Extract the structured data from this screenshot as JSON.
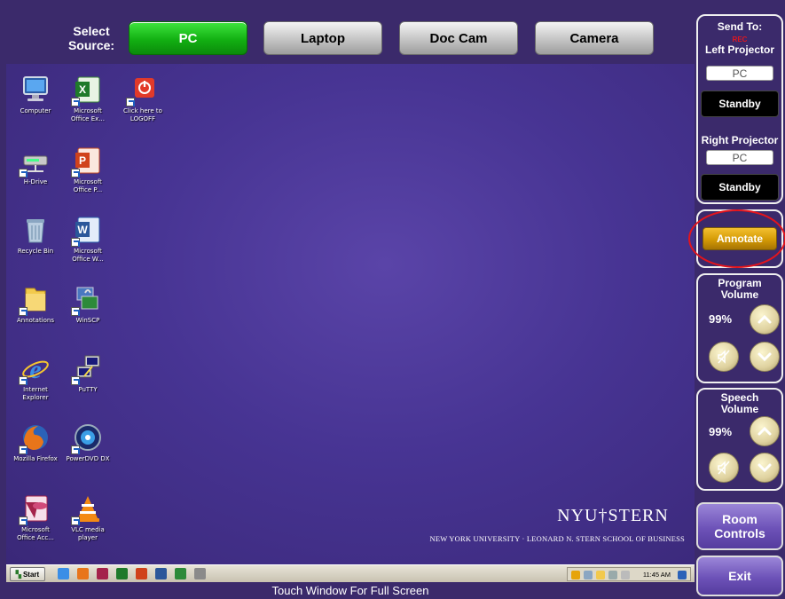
{
  "source_bar": {
    "label": "Select\nSource:",
    "buttons": [
      {
        "label": "PC",
        "active": true
      },
      {
        "label": "Laptop",
        "active": false
      },
      {
        "label": "Doc Cam",
        "active": false
      },
      {
        "label": "Camera",
        "active": false
      }
    ]
  },
  "desktop": {
    "icons": [
      {
        "label": "Computer",
        "icon": "computer-icon"
      },
      {
        "label": "Microsoft\nOffice Ex...",
        "icon": "excel-icon"
      },
      {
        "label": "Click here to\nLOGOFF",
        "icon": "logoff-icon"
      },
      {
        "label": "H-Drive",
        "icon": "network-drive-icon"
      },
      {
        "label": "Microsoft\nOffice P...",
        "icon": "powerpoint-icon"
      },
      {
        "label": "Recycle Bin",
        "icon": "recycle-bin-icon"
      },
      {
        "label": "Microsoft\nOffice W...",
        "icon": "word-icon"
      },
      {
        "label": "Annotations",
        "icon": "folder-icon"
      },
      {
        "label": "WinSCP",
        "icon": "winscp-icon"
      },
      {
        "label": "Internet\nExplorer",
        "icon": "internet-explorer-icon"
      },
      {
        "label": "PuTTY",
        "icon": "putty-icon"
      },
      {
        "label": "Mozilla Firefox",
        "icon": "firefox-icon"
      },
      {
        "label": "PowerDVD DX",
        "icon": "powerdvd-icon"
      },
      {
        "label": "Microsoft\nOffice Acc...",
        "icon": "access-icon"
      },
      {
        "label": "VLC media\nplayer",
        "icon": "vlc-icon"
      }
    ],
    "brand": "NYU†STERN",
    "tagline": "NEW YORK UNIVERSITY · LEONARD N. STERN SCHOOL OF BUSINESS"
  },
  "taskbar": {
    "start_label": "Start",
    "clock": "11:45 AM"
  },
  "touch_hint": "Touch Window For Full Screen",
  "send_to": {
    "title": "Send To:",
    "rec": "REC",
    "left_projector": {
      "label": "Left Projector",
      "source": "PC",
      "button": "Standby"
    },
    "right_projector": {
      "label": "Right Projector",
      "source": "PC",
      "button": "Standby"
    }
  },
  "annotate": {
    "label": "Annotate"
  },
  "program_volume": {
    "title": "Program\nVolume",
    "level": "99%"
  },
  "speech_volume": {
    "title": "Speech\nVolume",
    "level": "99%"
  },
  "room_controls": {
    "label": "Room\nControls"
  },
  "exit": {
    "label": "Exit"
  },
  "colors": {
    "background": "#3b2a6b",
    "active_source": "#12b012",
    "annotate": "#d49a05",
    "rec": "#e0161f",
    "highlight_ring": "#e3141c"
  }
}
